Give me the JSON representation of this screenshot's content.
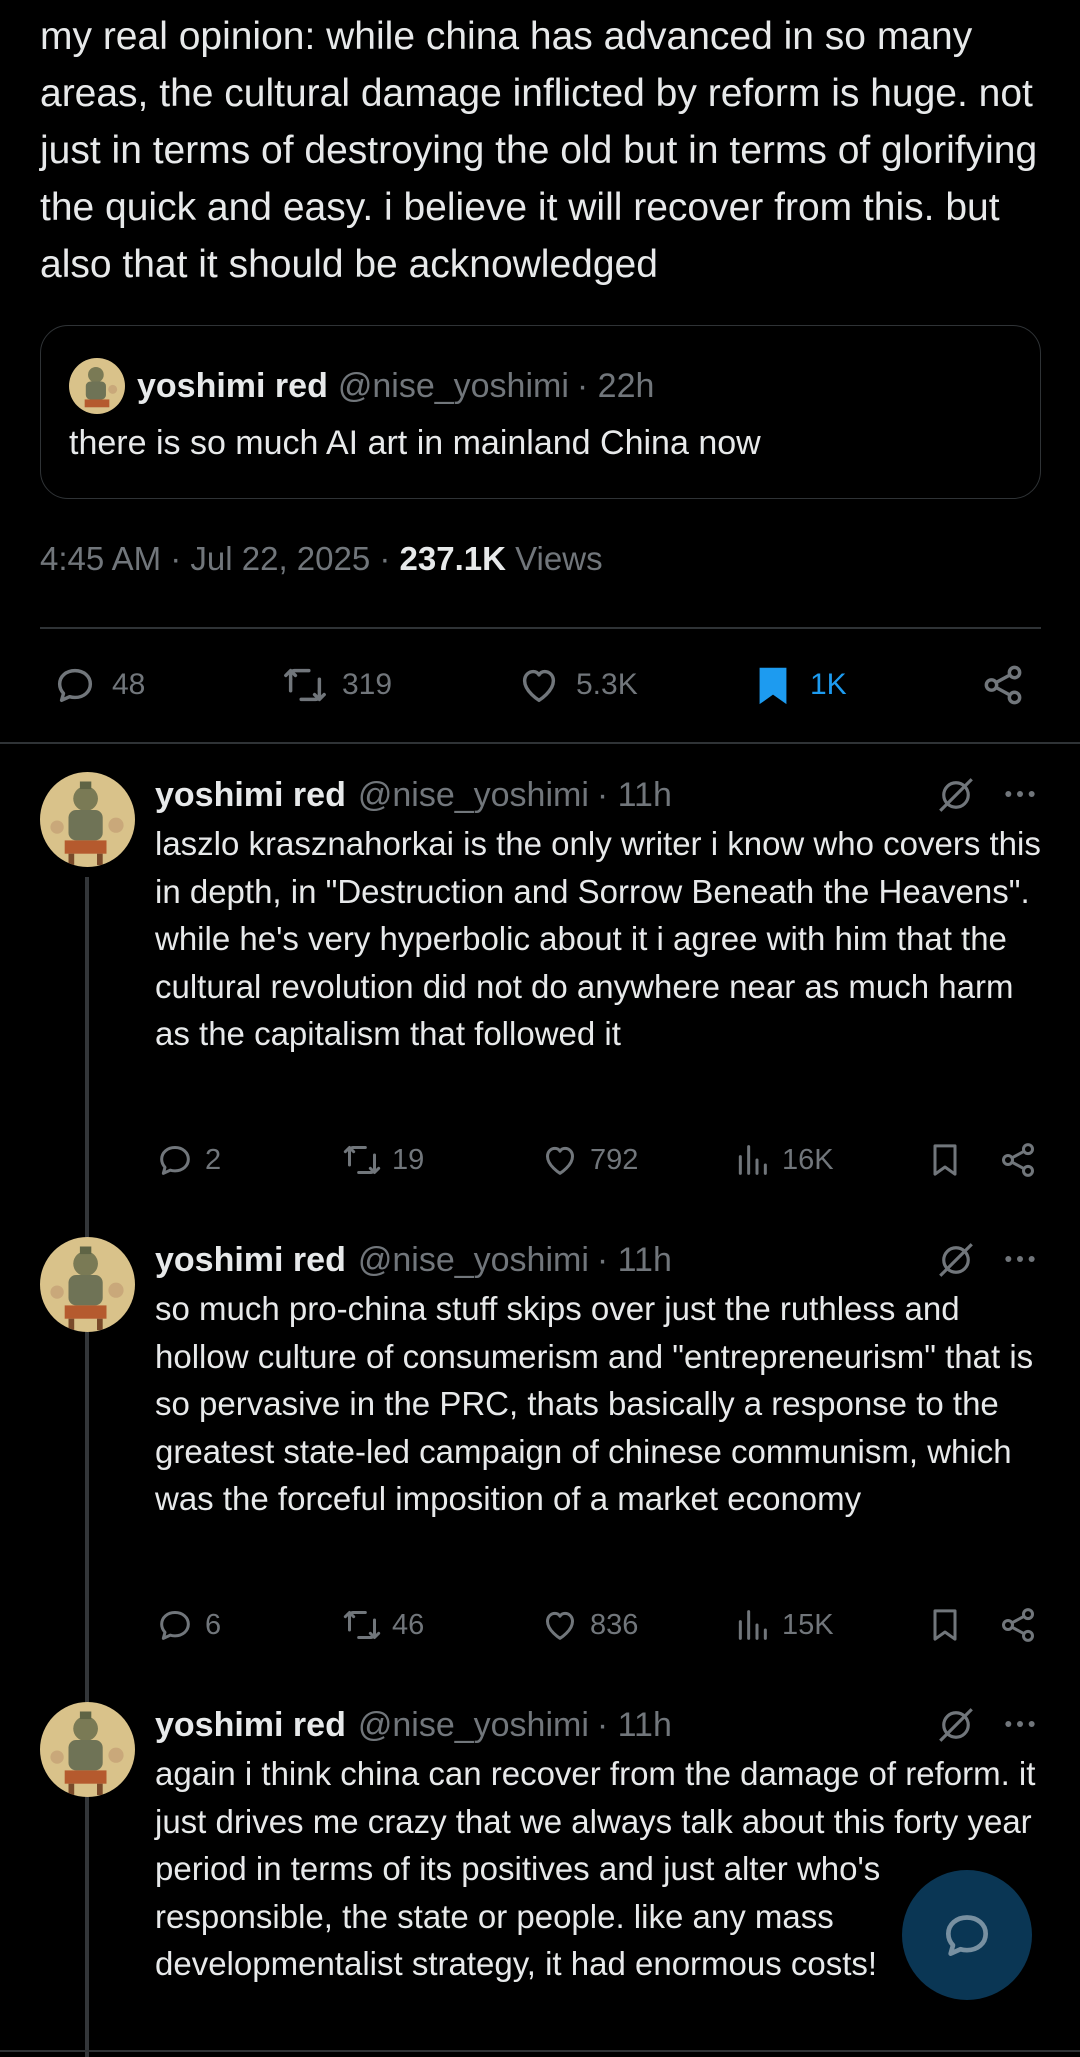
{
  "main_post": {
    "text": "my real opinion: while china has advanced in so many areas, the cultural damage inflicted by reform is huge. not just in terms of destroying the old but in terms of glorifying the quick and easy. i believe it will recover from this. but also that it should be acknowledged"
  },
  "quoted_post": {
    "name": "yoshimi red",
    "handle": "@nise_yoshimi",
    "time": "· 22h",
    "text": "there is so much AI art in mainland China now"
  },
  "meta": {
    "time_date": "4:45 AM · Jul 22, 2025 · ",
    "views_count": "237.1K",
    "views_label": " Views"
  },
  "actions": {
    "replies": "48",
    "reposts": "319",
    "likes": "5.3K",
    "bookmarks": "1K",
    "accent": "#1d9bf0"
  },
  "replies": [
    {
      "name": "yoshimi red",
      "handle": "@nise_yoshimi",
      "time": "· 11h",
      "text": "laszlo krasznahorkai is the only writer i know who covers this in depth, in \"Destruction and Sorrow Beneath the Heavens\". while he's very hyperbolic about it i agree with him that the cultural revolution did not do anywhere near as much harm as the capitalism that followed it",
      "replies": "2",
      "reposts": "19",
      "likes": "792",
      "views": "16K"
    },
    {
      "name": "yoshimi red",
      "handle": "@nise_yoshimi",
      "time": "· 11h",
      "text": "so much pro-china stuff skips over just the ruthless and hollow culture of consumerism and \"entrepreneurism\" that is so pervasive in the PRC, thats basically a response to the greatest state-led campaign of chinese communism, which was the forceful imposition of a market economy",
      "replies": "6",
      "reposts": "46",
      "likes": "836",
      "views": "15K"
    },
    {
      "name": "yoshimi red",
      "handle": "@nise_yoshimi",
      "time": "· 11h",
      "text": "again i think china can recover from the damage of reform. it just drives me crazy that we always talk about this forty year period in terms of its positives and just alter who's responsible, the state or people. like any mass developmentalist strategy, it had enormous costs!"
    }
  ]
}
